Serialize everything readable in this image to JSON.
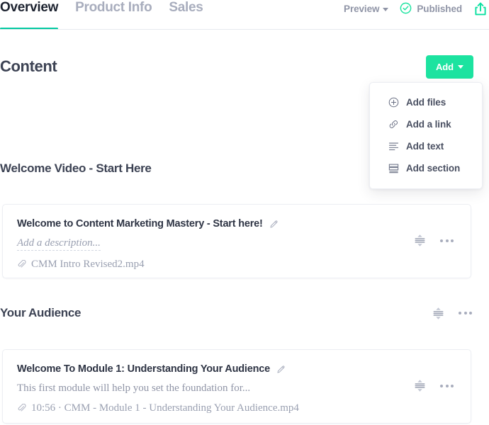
{
  "theme": {
    "accent": "#1ce3a0",
    "accent_deep": "#00c9a0",
    "text_dark": "#2e3444",
    "text_muted": "#8f94a6",
    "border": "#eceef3"
  },
  "tabs": [
    {
      "label": "Overview",
      "active": true
    },
    {
      "label": "Product Info",
      "active": false
    },
    {
      "label": "Sales",
      "active": false
    }
  ],
  "topbar": {
    "preview_label": "Preview",
    "preview_caret_icon": "chevron-down-icon",
    "published_label": "Published",
    "published_icon": "check-circle-icon",
    "share_icon": "share-upload-icon"
  },
  "content_header": {
    "title": "Content",
    "add_label": "Add",
    "add_caret_icon": "chevron-down-icon"
  },
  "add_menu": {
    "open": true,
    "items": [
      {
        "label": "Add files",
        "icon": "plus-circle-icon"
      },
      {
        "label": "Add a link",
        "icon": "link-icon"
      },
      {
        "label": "Add text",
        "icon": "text-lines-icon"
      },
      {
        "label": "Add section",
        "icon": "section-stack-icon"
      }
    ]
  },
  "sections": [
    {
      "title": "Welcome Video - Start Here",
      "has_actions": false,
      "drag_icon": "drag-handle-icon",
      "more_icon": "more-horizontal-icon",
      "items": [
        {
          "title": "Welcome to Content Marketing Mastery - Start here!",
          "edit_icon": "pencil-icon",
          "description": "Add a description...",
          "description_is_placeholder": true,
          "file_icon": "paperclip-icon",
          "file_meta": "CMM Intro Revised2.mp4",
          "drag_icon": "drag-handle-icon",
          "more_icon": "more-horizontal-icon"
        }
      ]
    },
    {
      "title": "Your Audience",
      "has_actions": true,
      "drag_icon": "drag-handle-icon",
      "more_icon": "more-horizontal-icon",
      "items": [
        {
          "title": "Welcome To Module 1: Understanding Your Audience",
          "edit_icon": "pencil-icon",
          "description": "This first module will help you set the foundation for...",
          "description_is_placeholder": false,
          "file_icon": "paperclip-icon",
          "file_meta": "10:56 · CMM - Module 1 - Understanding Your Audience.mp4",
          "drag_icon": "drag-handle-icon",
          "more_icon": "more-horizontal-icon"
        }
      ]
    }
  ]
}
